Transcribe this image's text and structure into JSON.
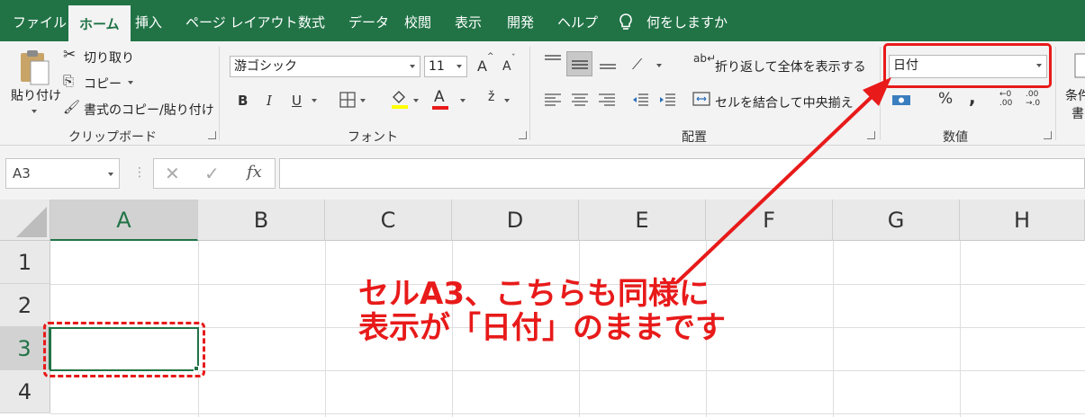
{
  "tabs": [
    "ファイル",
    "ホーム",
    "挿入",
    "ページ レイアウト",
    "数式",
    "データ",
    "校閲",
    "表示",
    "開発",
    "ヘルプ"
  ],
  "tell_me": "何をしますか",
  "clipboard": {
    "paste": "貼り付け",
    "cut": "切り取り",
    "copy": "コピー",
    "format_painter": "書式のコピー/貼り付け",
    "label": "クリップボード"
  },
  "font": {
    "name": "游ゴシック",
    "size": "11",
    "grow": "A",
    "shrink": "A",
    "bold": "B",
    "italic": "I",
    "underline": "U",
    "color_letter": "A",
    "label": "フォント"
  },
  "alignment": {
    "wrap": "折り返して全体を表示する",
    "merge": "セルを結合して中央揃え",
    "label": "配置"
  },
  "number": {
    "format": "日付",
    "percent": "%",
    "comma": ",",
    "label": "数値"
  },
  "styles": {
    "cond_top": "条件",
    "cond_bottom": "書"
  },
  "namebox": "A3",
  "fx": "fx",
  "columns": [
    "A",
    "B",
    "C",
    "D",
    "E",
    "F",
    "G",
    "H"
  ],
  "rows": [
    "1",
    "2",
    "3",
    "4"
  ],
  "annotation": {
    "line1": "セルA3、こちらも同様に",
    "line2": "表示が「日付」のままです"
  },
  "colors": {
    "excel_green": "#217346",
    "annotation_red": "#e81a1a"
  }
}
